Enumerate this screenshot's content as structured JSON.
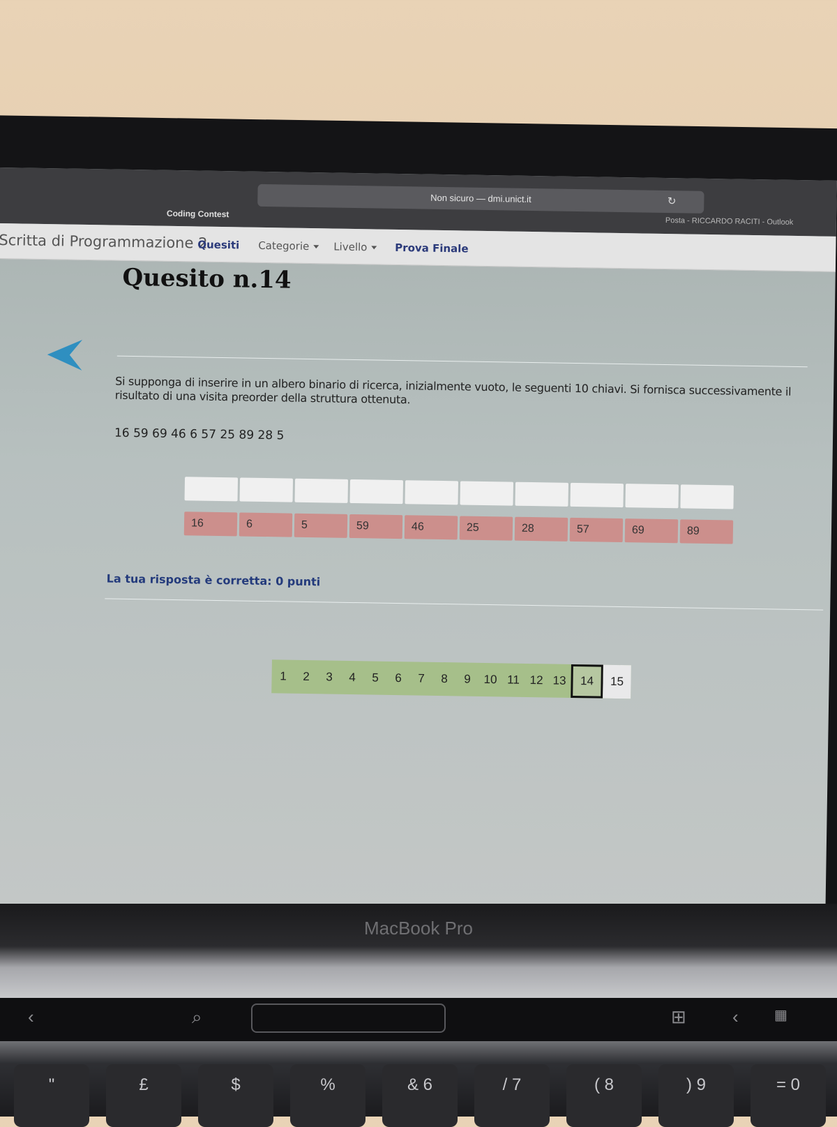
{
  "browser": {
    "url": "Non sicuro — dmi.unict.it",
    "tab_left": "Coding Contest",
    "tab_right": "Posta - RICCARDO RACITI - Outlook"
  },
  "nav": {
    "brand": "Scritta di Programmazione 2",
    "quesiti": "Quesiti",
    "categorie": "Categorie",
    "livello": "Livello",
    "prova_finale": "Prova Finale"
  },
  "question": {
    "title": "Quesito n.14",
    "text": "Si supponga di inserire in un albero binario di ricerca, inizialmente vuoto, le seguenti 10 chiavi. Si fornisca successivamente il risultato di una visita preorder della struttura ottenuta.",
    "keys": "16 59 69 46 6 57 25 89 28 5"
  },
  "answer_chips": [
    "16",
    "6",
    "5",
    "59",
    "46",
    "25",
    "28",
    "57",
    "69",
    "89"
  ],
  "result": "La tua risposta è corretta: 0 punti",
  "pager": [
    "1",
    "2",
    "3",
    "4",
    "5",
    "6",
    "7",
    "8",
    "9",
    "10",
    "11",
    "12",
    "13",
    "14",
    "15"
  ],
  "laptop": {
    "label": "MacBook Pro"
  },
  "keyboard": [
    {
      "top": "\"",
      "bottom": ""
    },
    {
      "top": "£",
      "bottom": ""
    },
    {
      "top": "$",
      "bottom": ""
    },
    {
      "top": "%",
      "bottom": ""
    },
    {
      "top": "&",
      "bottom": "6"
    },
    {
      "top": "/",
      "bottom": "7"
    },
    {
      "top": "(",
      "bottom": "8"
    },
    {
      "top": ")",
      "bottom": "9"
    },
    {
      "top": "=",
      "bottom": "0"
    }
  ],
  "colors": {
    "chip": "#cc8f8c",
    "pager_done": "#a6bf8a",
    "link": "#243b7c",
    "arrow": "#2f8fc0"
  }
}
